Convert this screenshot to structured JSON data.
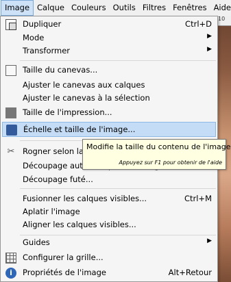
{
  "menubar": {
    "items": [
      "Image",
      "Calque",
      "Couleurs",
      "Outils",
      "Filtres",
      "Fenêtres",
      "Aide"
    ],
    "active": 0
  },
  "ruler_value": "10",
  "menu": {
    "items": [
      {
        "label": "Dupliquer",
        "shortcut": "Ctrl+D",
        "icon": "duplicate-icon"
      },
      {
        "label": "Mode",
        "submenu": "▶"
      },
      {
        "label": "Transformer",
        "submenu": "▶"
      },
      {
        "label": "Taille du canevas...",
        "icon": "canvas-size-icon"
      },
      {
        "label": "Ajuster le canevas aux calques"
      },
      {
        "label": "Ajuster le canevas à la sélection"
      },
      {
        "label": "Taille de l'impression...",
        "icon": "print-size-icon"
      },
      {
        "label": "Échelle et taille de l'image...",
        "icon": "scale-image-icon"
      },
      {
        "label": "Rogner selon la sélection",
        "icon": "crop-icon"
      },
      {
        "label": "Découpage automatique de l'image"
      },
      {
        "label": "Découpage futé..."
      },
      {
        "label": "Fusionner les calques visibles...",
        "shortcut": "Ctrl+M"
      },
      {
        "label": "Aplatir l'image"
      },
      {
        "label": "Aligner les calques visibles..."
      },
      {
        "label": "Guides",
        "submenu": "▶"
      },
      {
        "label": "Configurer la grille...",
        "icon": "grid-icon"
      },
      {
        "label": "Propriétés de l'image",
        "shortcut": "Alt+Retour",
        "icon": "info-icon"
      }
    ]
  },
  "tooltip": {
    "text": "Modifie la taille du contenu de l'image",
    "hint": "Appuyez sur F1 pour obtenir de l'aide"
  }
}
